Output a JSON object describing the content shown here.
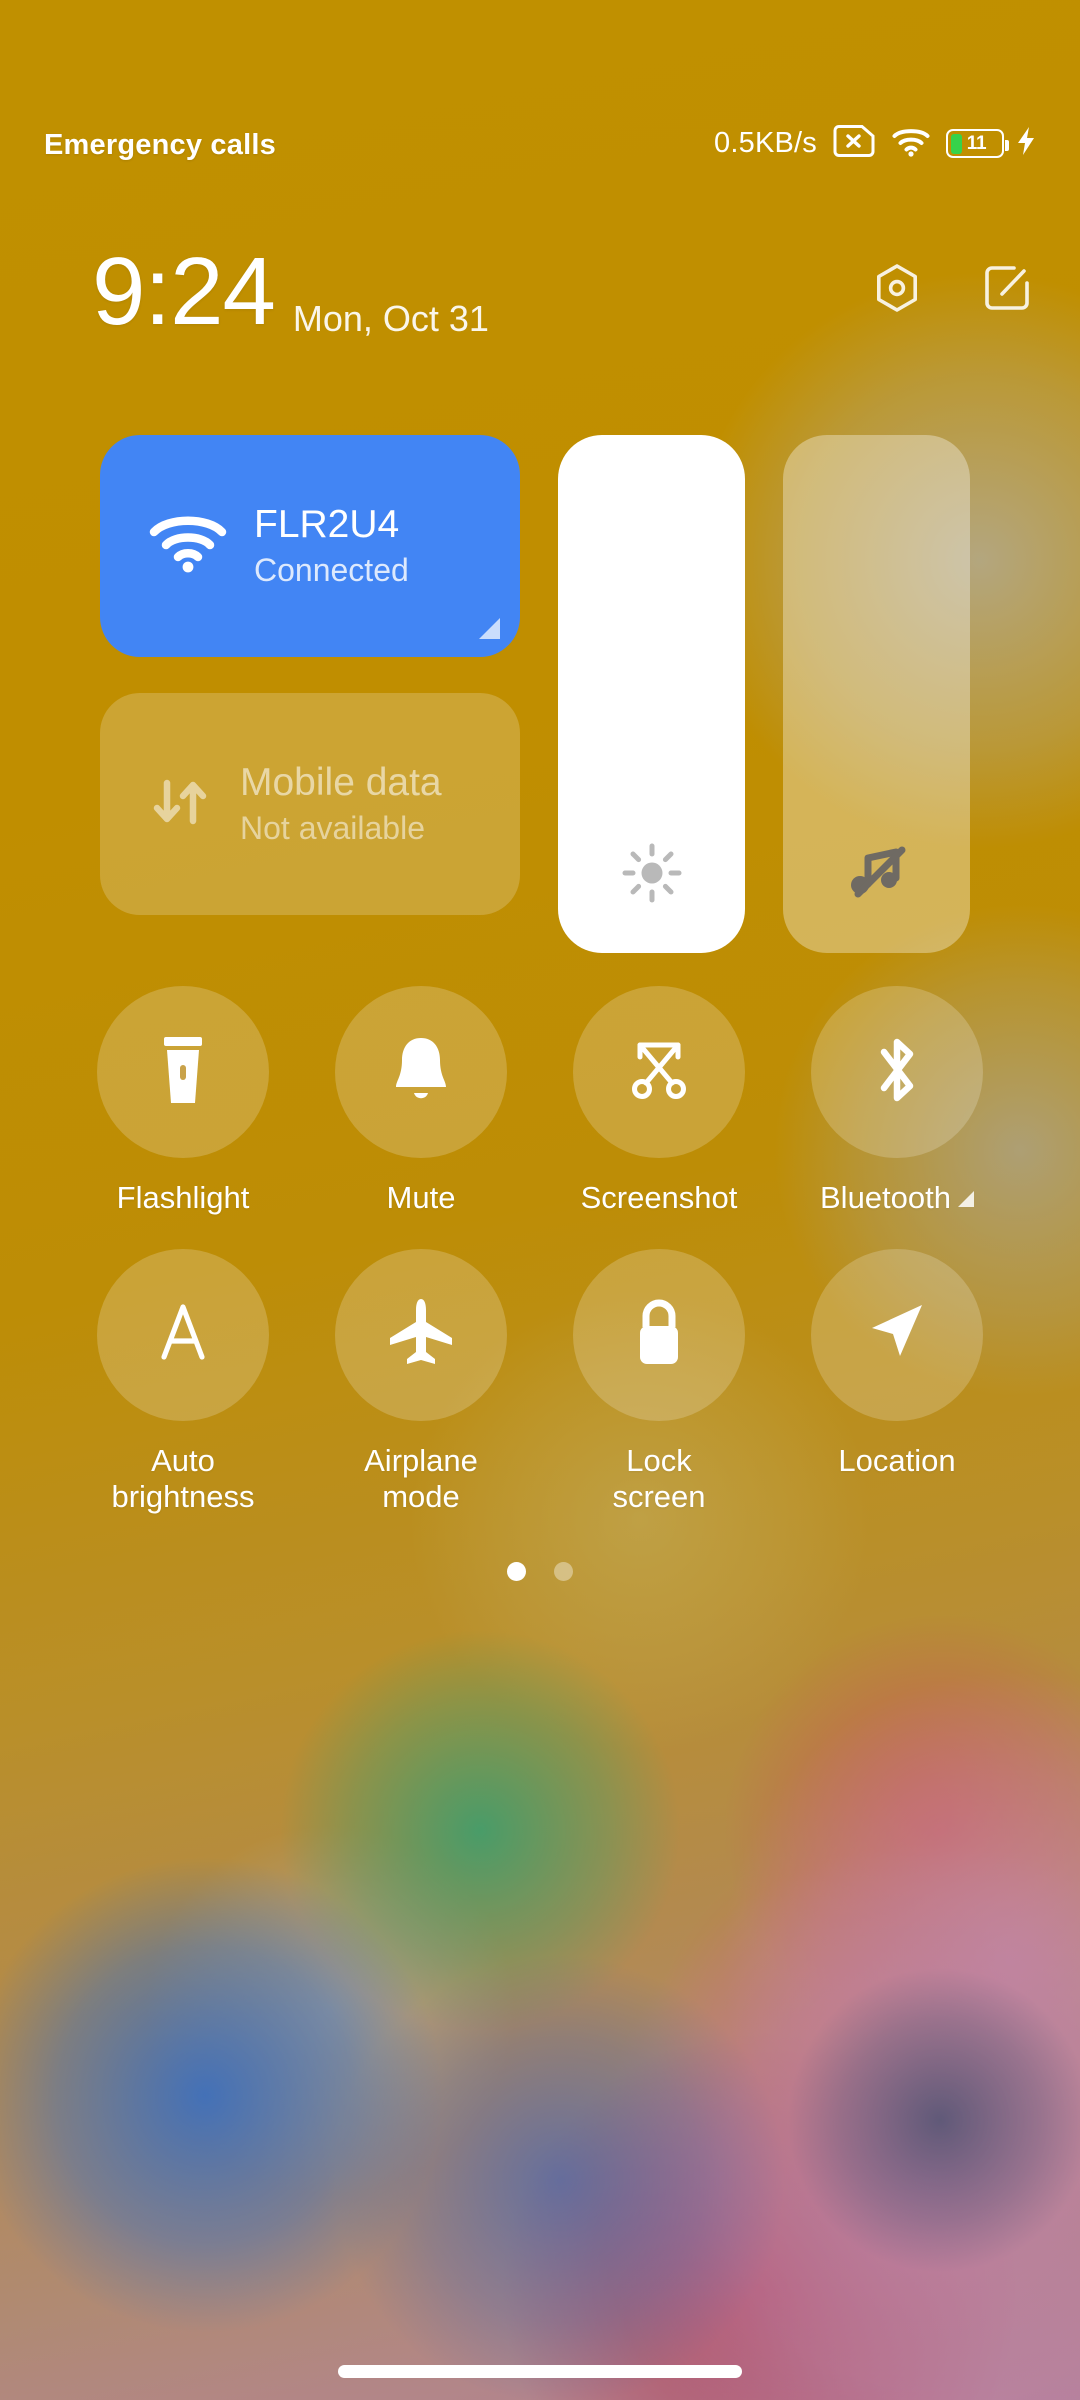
{
  "status_bar": {
    "carrier": "Emergency calls",
    "network_speed": "0.5KB/s",
    "sim_icon": "sim-card-disabled-icon",
    "wifi_icon": "wifi-icon",
    "battery_level": "11",
    "battery_icon": "battery-icon",
    "charging_icon": "charging-bolt-icon"
  },
  "header": {
    "time": "9:24",
    "date": "Mon, Oct 31",
    "settings_icon": "hexagon-settings-icon",
    "edit_icon": "edit-tiles-icon"
  },
  "tiles": {
    "wifi": {
      "title": "FLR2U4",
      "subtitle": "Connected",
      "icon": "wifi-icon",
      "active": true,
      "accent_color": "#4285f4"
    },
    "mobile_data": {
      "title": "Mobile data",
      "subtitle": "Not available",
      "icon": "mobile-data-icon",
      "active": false
    },
    "brightness_slider": {
      "icon": "brightness-sun-icon",
      "level_percent": "100",
      "fill_color": "#ffffff"
    },
    "volume_slider": {
      "icon": "music-muted-icon",
      "level_percent": "0"
    }
  },
  "toggles": {
    "row1": [
      {
        "label": "Flashlight",
        "icon": "flashlight-icon",
        "expandable": false
      },
      {
        "label": "Mute",
        "icon": "bell-icon",
        "expandable": false
      },
      {
        "label": "Screenshot",
        "icon": "scissors-screenshot-icon",
        "expandable": false
      },
      {
        "label": "Bluetooth",
        "icon": "bluetooth-icon",
        "expandable": true
      }
    ],
    "row2": [
      {
        "label": "Auto\nbrightness",
        "icon": "auto-brightness-a-icon",
        "expandable": false
      },
      {
        "label": "Airplane\nmode",
        "icon": "airplane-icon",
        "expandable": false
      },
      {
        "label": "Lock\nscreen",
        "icon": "padlock-icon",
        "expandable": false
      },
      {
        "label": "Location",
        "icon": "location-arrow-icon",
        "expandable": false
      }
    ]
  },
  "pagination": {
    "total_pages": 2,
    "current_page": 1
  },
  "home_indicator": {
    "name": "home-gesture-bar"
  }
}
